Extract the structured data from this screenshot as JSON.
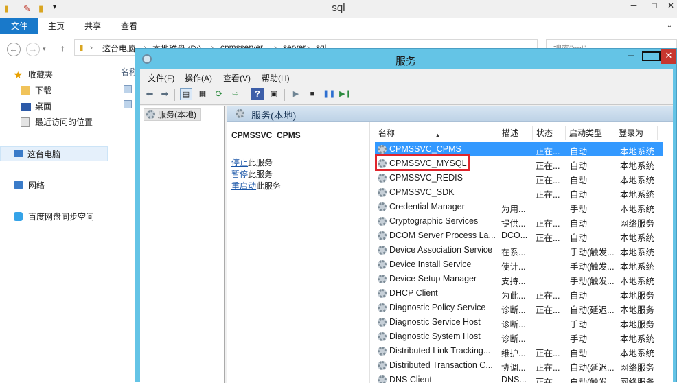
{
  "explorer": {
    "title": "sql",
    "ribbon_tabs": [
      "文件",
      "主页",
      "共享",
      "查看"
    ],
    "breadcrumbs": [
      "这台电脑",
      "本地磁盘 (D:)",
      "cpmsserver",
      "server",
      "sql"
    ],
    "search_placeholder": "搜索\"sql\"",
    "nav": {
      "favorites": "收藏夹",
      "downloads": "下载",
      "desktop": "桌面",
      "recent": "最近访问的位置",
      "this_pc": "这台电脑",
      "network": "网络",
      "baidu": "百度网盘同步空间"
    },
    "column_name": "名称"
  },
  "services": {
    "title": "服务",
    "menu": [
      "文件(F)",
      "操作(A)",
      "查看(V)",
      "帮助(H)"
    ],
    "tree_item": "服务(本地)",
    "pane_title": "服务(本地)",
    "selected_service": "CPMSSVC_CPMS",
    "actions": [
      {
        "link": "停止",
        "rest": "此服务"
      },
      {
        "link": "暂停",
        "rest": "此服务"
      },
      {
        "link": "重启动",
        "rest": "此服务"
      }
    ],
    "columns": [
      "名称",
      "描述",
      "状态",
      "启动类型",
      "登录为"
    ],
    "rows": [
      {
        "name": "CPMSSVC_CPMS",
        "desc": "",
        "status": "正在...",
        "startup": "自动",
        "logon": "本地系统"
      },
      {
        "name": "CPMSSVC_MYSQL",
        "desc": "",
        "status": "正在...",
        "startup": "自动",
        "logon": "本地系统"
      },
      {
        "name": "CPMSSVC_REDIS",
        "desc": "",
        "status": "正在...",
        "startup": "自动",
        "logon": "本地系统"
      },
      {
        "name": "CPMSSVC_SDK",
        "desc": "",
        "status": "正在...",
        "startup": "自动",
        "logon": "本地系统"
      },
      {
        "name": "Credential Manager",
        "desc": "为用...",
        "status": "",
        "startup": "手动",
        "logon": "本地系统"
      },
      {
        "name": "Cryptographic Services",
        "desc": "提供...",
        "status": "正在...",
        "startup": "自动",
        "logon": "网络服务"
      },
      {
        "name": "DCOM Server Process La...",
        "desc": "DCO...",
        "status": "正在...",
        "startup": "自动",
        "logon": "本地系统"
      },
      {
        "name": "Device Association Service",
        "desc": "在系...",
        "status": "",
        "startup": "手动(触发...",
        "logon": "本地系统"
      },
      {
        "name": "Device Install Service",
        "desc": "使计...",
        "status": "",
        "startup": "手动(触发...",
        "logon": "本地系统"
      },
      {
        "name": "Device Setup Manager",
        "desc": "支持...",
        "status": "",
        "startup": "手动(触发...",
        "logon": "本地系统"
      },
      {
        "name": "DHCP Client",
        "desc": "为此...",
        "status": "正在...",
        "startup": "自动",
        "logon": "本地服务"
      },
      {
        "name": "Diagnostic Policy Service",
        "desc": "诊断...",
        "status": "正在...",
        "startup": "自动(延迟...",
        "logon": "本地服务"
      },
      {
        "name": "Diagnostic Service Host",
        "desc": "诊断...",
        "status": "",
        "startup": "手动",
        "logon": "本地服务"
      },
      {
        "name": "Diagnostic System Host",
        "desc": "诊断...",
        "status": "",
        "startup": "手动",
        "logon": "本地系统"
      },
      {
        "name": "Distributed Link Tracking...",
        "desc": "维护...",
        "status": "正在...",
        "startup": "自动",
        "logon": "本地系统"
      },
      {
        "name": "Distributed Transaction C...",
        "desc": "协调...",
        "status": "正在...",
        "startup": "自动(延迟...",
        "logon": "网络服务"
      },
      {
        "name": "DNS Client",
        "desc": "DNS...",
        "status": "正在...",
        "startup": "自动(触发...",
        "logon": "网络服务"
      }
    ]
  },
  "colors": {
    "selection": "#3399ff",
    "window_frame": "#64c4e6",
    "highlight_box": "#e0252c"
  }
}
